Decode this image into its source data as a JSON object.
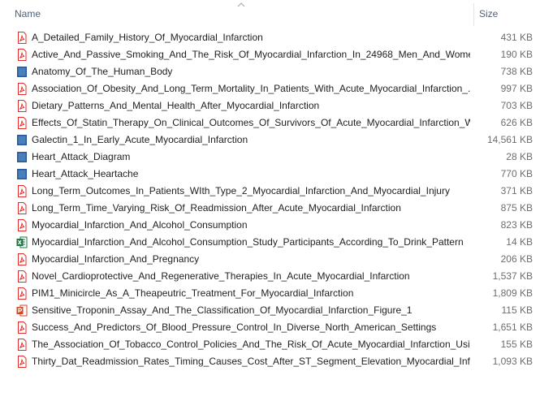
{
  "header": {
    "name_label": "Name",
    "size_label": "Size",
    "sort_icon": "chevron-up-icon"
  },
  "colors": {
    "pdf": "#e32c2c",
    "word": "#2b579a",
    "excel": "#217346",
    "powerpoint": "#d24726",
    "header_text": "#4c607a"
  },
  "files": [
    {
      "icon": "pdf",
      "name": "A_Detailed_Family_History_Of_Myocardial_Infarction",
      "size": "431 KB"
    },
    {
      "icon": "pdf",
      "name": "Active_And_Passive_Smoking_And_The_Risk_Of_Myocardial_Infarction_In_24968_Men_And_Women...",
      "size": "190 KB"
    },
    {
      "icon": "word",
      "name": "Anatomy_Of_The_Human_Body",
      "size": "738 KB"
    },
    {
      "icon": "pdf",
      "name": "Association_Of_Obesity_And_Long_Term_Mortality_In_Patients_With_Acute_Myocardial_Infarction_...",
      "size": "997 KB"
    },
    {
      "icon": "pdf",
      "name": "Dietary_Patterns_And_Mental_Health_After_Myocardial_Infarction",
      "size": "703 KB"
    },
    {
      "icon": "pdf",
      "name": "Effects_Of_Statin_Therapy_On_Clinical_Outcomes_Of_Survivors_Of_Acute_Myocardial_Infarction_Wi...",
      "size": "626 KB"
    },
    {
      "icon": "word",
      "name": "Galectin_1_In_Early_Acute_Myocardial_Infarction",
      "size": "14,561 KB"
    },
    {
      "icon": "word",
      "name": "Heart_Attack_Diagram",
      "size": "28 KB"
    },
    {
      "icon": "word",
      "name": "Heart_Attack_Heartache",
      "size": "770 KB"
    },
    {
      "icon": "pdf",
      "name": "Long_Term_Outcomes_In_Patients_WIth_Type_2_Myocardial_Infarction_And_Myocardial_Injury",
      "size": "371 KB"
    },
    {
      "icon": "pdf",
      "name": "Long_Term_Time_Varying_Risk_Of_Readmission_After_Acute_Myocardial_Infarction",
      "size": "875 KB"
    },
    {
      "icon": "pdf",
      "name": "Myocardial_Infarction_And_Alcohol_Consumption",
      "size": "823 KB"
    },
    {
      "icon": "excel",
      "name": "Myocardial_Infarction_And_Alcohol_Consumption_Study_Participants_According_To_Drink_Pattern",
      "size": "14 KB"
    },
    {
      "icon": "pdf",
      "name": "Myocardial_Infarction_And_Pregnancy",
      "size": "206 KB"
    },
    {
      "icon": "pdf",
      "name": "Novel_Cardioprotective_And_Regenerative_Therapies_In_Acute_Myocardial_Infarction",
      "size": "1,537 KB"
    },
    {
      "icon": "pdf",
      "name": "PIM1_Minicircle_As_A_Theapeutric_Treatment_For_Myocardial_Infarction",
      "size": "1,809 KB"
    },
    {
      "icon": "powerpoint",
      "name": "Sensitive_Troponin_Assay_And_The_Classification_Of_Myocardial_Infarction_Figure_1",
      "size": "115 KB"
    },
    {
      "icon": "pdf",
      "name": "Success_And_Predictors_Of_Blood_Pressure_Control_In_Diverse_North_American_Settings",
      "size": "1,651 KB"
    },
    {
      "icon": "pdf",
      "name": "The_Association_Of_Tobacco_Control_Policies_And_The_Risk_Of_Acute_Myocardial_Infarction_Usin...",
      "size": "155 KB"
    },
    {
      "icon": "pdf",
      "name": "Thirty_Dat_Readmission_Rates_Timing_Causes_Cost_After_ST_Segment_Elevation_Myocardial_Infarc...",
      "size": "1,093 KB"
    }
  ]
}
